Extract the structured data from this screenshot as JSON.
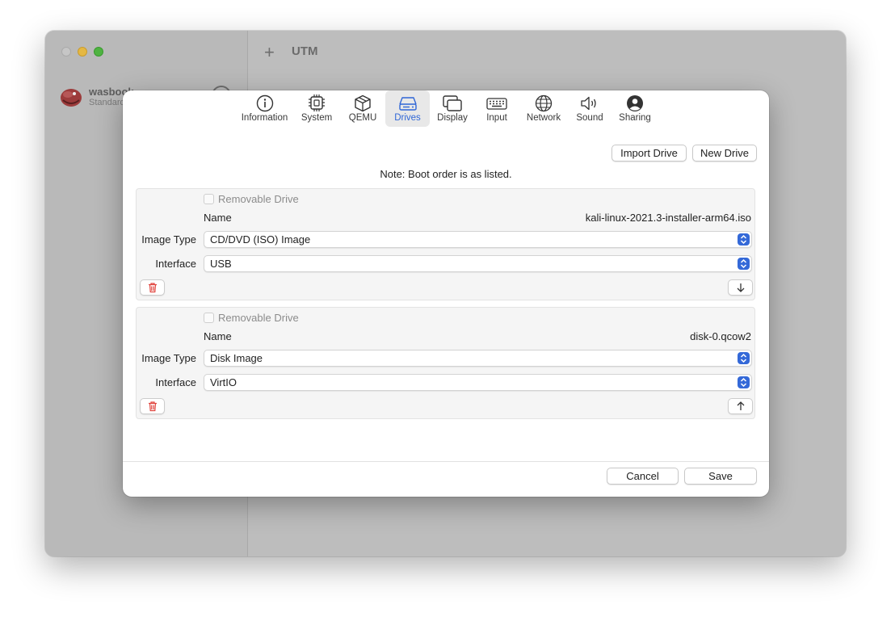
{
  "app": {
    "title": "UTM",
    "vm": {
      "name": "wasbook",
      "status": "Standard"
    }
  },
  "tabs": [
    {
      "label": "Information",
      "icon": "info-circle-icon"
    },
    {
      "label": "System",
      "icon": "cpu-chip-icon"
    },
    {
      "label": "QEMU",
      "icon": "cube-icon"
    },
    {
      "label": "Drives",
      "icon": "drive-icon",
      "active": true
    },
    {
      "label": "Display",
      "icon": "display-windows-icon"
    },
    {
      "label": "Input",
      "icon": "keyboard-icon"
    },
    {
      "label": "Network",
      "icon": "globe-icon"
    },
    {
      "label": "Sound",
      "icon": "speaker-icon"
    },
    {
      "label": "Sharing",
      "icon": "person-circle-icon"
    }
  ],
  "toolbar": {
    "import_label": "Import Drive",
    "new_label": "New Drive"
  },
  "note": "Note: Boot order is as listed.",
  "drives": [
    {
      "removable_label": "Removable Drive",
      "removable_checked": false,
      "name_label": "Name",
      "name": "kali-linux-2021.3-installer-arm64.iso",
      "image_type_label": "Image Type",
      "image_type": "CD/DVD (ISO) Image",
      "interface_label": "Interface",
      "interface": "USB",
      "move": "down"
    },
    {
      "removable_label": "Removable Drive",
      "removable_checked": false,
      "name_label": "Name",
      "name": "disk-0.qcow2",
      "image_type_label": "Image Type",
      "image_type": "Disk Image",
      "interface_label": "Interface",
      "interface": "VirtIO",
      "move": "up"
    }
  ],
  "footer": {
    "cancel_label": "Cancel",
    "save_label": "Save"
  },
  "colors": {
    "accent": "#2f66d6",
    "stepper": "#3469d8",
    "trash": "#e0443e"
  }
}
